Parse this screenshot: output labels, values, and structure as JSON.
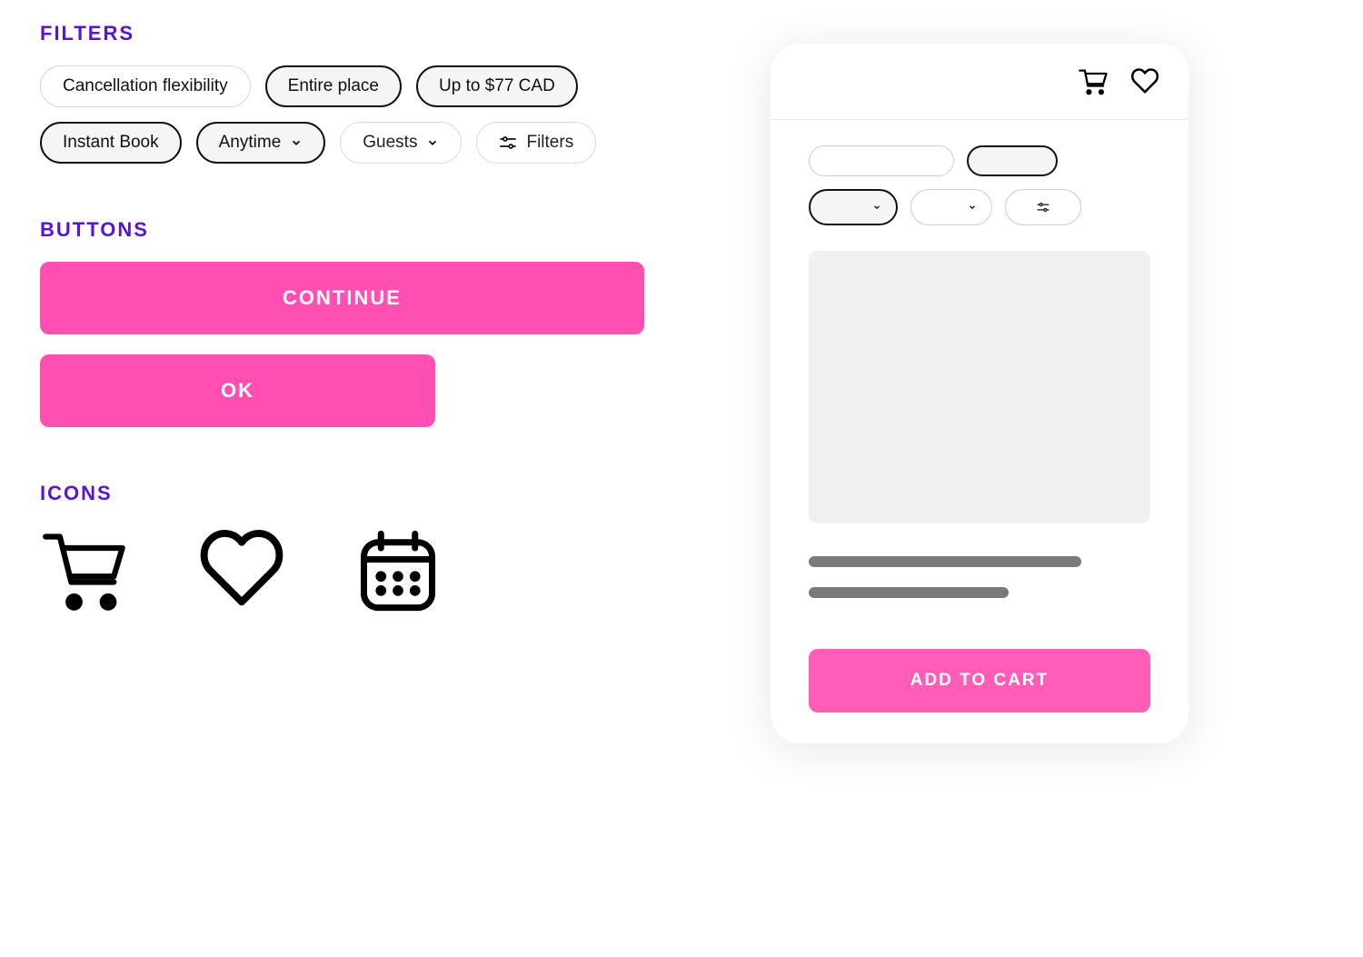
{
  "sections": {
    "filters_title": "FILTERS",
    "buttons_title": "BUTTONS",
    "icons_title": "ICONS"
  },
  "filters": {
    "chips": [
      {
        "label": "Cancellation flexibility",
        "selected": false,
        "dropdown": false
      },
      {
        "label": "Entire place",
        "selected": true,
        "dropdown": false
      },
      {
        "label": "Up to $77 CAD",
        "selected": true,
        "dropdown": false
      },
      {
        "label": "Instant Book",
        "selected": true,
        "dropdown": false
      },
      {
        "label": "Anytime",
        "selected": true,
        "dropdown": true
      },
      {
        "label": "Guests",
        "selected": false,
        "dropdown": true
      }
    ],
    "filters_label": "Filters"
  },
  "buttons": {
    "continue": "CONTINUE",
    "ok": "OK"
  },
  "icons": {
    "cart": "cart-icon",
    "heart": "heart-icon",
    "calendar": "calendar-icon"
  },
  "card": {
    "add_to_cart": "ADD TO CART"
  },
  "colors": {
    "accent_purple": "#5a12e0",
    "primary_pink": "#ff4fb2"
  }
}
